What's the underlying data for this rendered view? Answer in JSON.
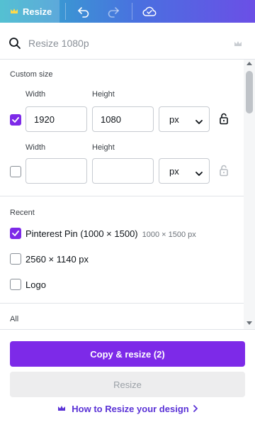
{
  "toolbar": {
    "resize_label": "Resize",
    "undo_icon": "undo-icon",
    "redo_icon": "redo-icon",
    "save_icon": "cloud-check-icon",
    "crown_icon": "crown-icon"
  },
  "search": {
    "placeholder": "Resize 1080p",
    "value": ""
  },
  "custom_size": {
    "title": "Custom size",
    "rows": [
      {
        "checked": true,
        "width_label": "Width",
        "height_label": "Height",
        "width": "1920",
        "height": "1080",
        "unit": "px",
        "lock_icon": "unlock-icon"
      },
      {
        "checked": false,
        "width_label": "Width",
        "height_label": "Height",
        "width": "",
        "height": "",
        "unit": "px",
        "lock_icon": "unlock-icon"
      }
    ]
  },
  "recent": {
    "title": "Recent",
    "items": [
      {
        "label": "Pinterest Pin (1000 × 1500)",
        "sub": "1000 × 1500 px",
        "checked": true
      },
      {
        "label": "2560 × 1140 px",
        "sub": "",
        "checked": false
      },
      {
        "label": "Logo",
        "sub": "",
        "checked": false
      }
    ]
  },
  "all": {
    "title": "All"
  },
  "footer": {
    "copy_resize_label": "Copy & resize (2)",
    "resize_label": "Resize",
    "howto_label": "How to Resize your design"
  },
  "colors": {
    "accent": "#7d2ae8",
    "link": "#5a32d6",
    "toolbar_gradient_start": "#2fb3c9",
    "toolbar_gradient_end": "#6b4fe6"
  }
}
